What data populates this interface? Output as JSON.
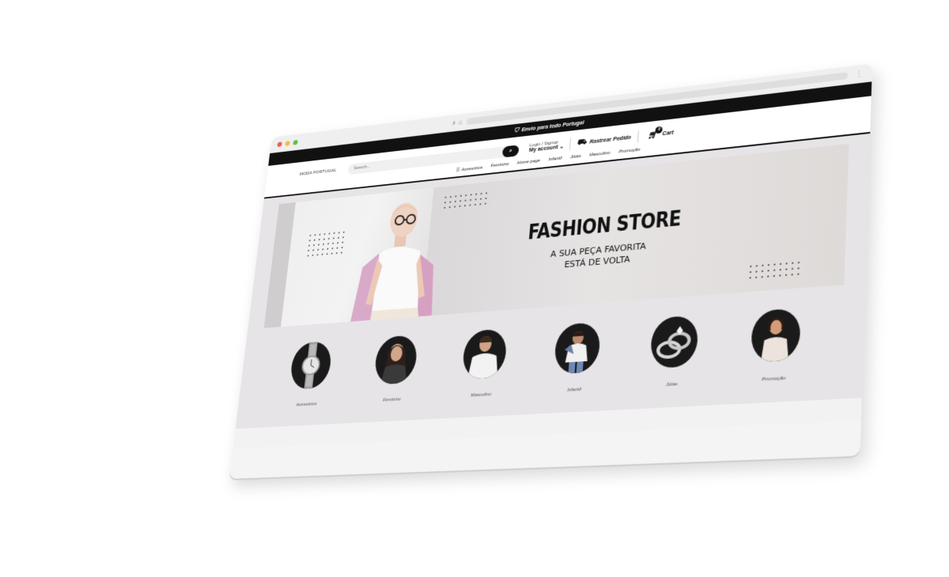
{
  "topbar": {
    "text": "Envio para todo Portugal"
  },
  "header": {
    "logo": "MODA PORTUGAL",
    "search_placeholder": "Search...",
    "login": "Login / Signup",
    "my_account": "My account",
    "track": "Rastrear Pedido",
    "cart": "Cart",
    "cart_count": "0"
  },
  "nav": {
    "items": [
      {
        "label": "Acessórios"
      },
      {
        "label": "Feminino"
      },
      {
        "label": "Home page"
      },
      {
        "label": "Infantil"
      },
      {
        "label": "Jóias"
      },
      {
        "label": "Masculino"
      },
      {
        "label": "Promoção"
      }
    ]
  },
  "hero": {
    "title": "FASHION STORE",
    "subtitle_1": "A SUA PEÇA FAVORITA",
    "subtitle_2": "ESTÁ DE VOLTA"
  },
  "categories": [
    {
      "label": "Acessórios",
      "icon": "watch-icon"
    },
    {
      "label": "Feminino",
      "icon": "woman-icon"
    },
    {
      "label": "Masculino",
      "icon": "man-icon"
    },
    {
      "label": "Infantil",
      "icon": "child-icon"
    },
    {
      "label": "Jóias",
      "icon": "rings-icon"
    },
    {
      "label": "Promoção",
      "icon": "promo-icon"
    }
  ]
}
